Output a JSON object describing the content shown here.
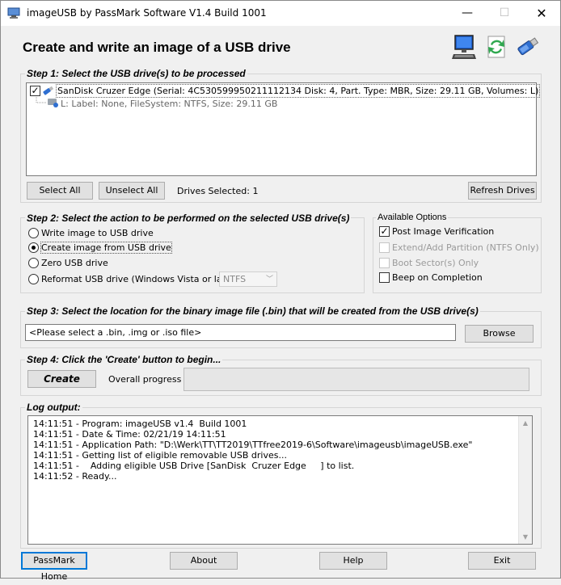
{
  "window": {
    "title": "imageUSB by PassMark Software V1.4 Build 1001",
    "minimize": "—",
    "maximize": "☐",
    "close": "✕"
  },
  "header": {
    "title": "Create and write an image of a USB drive",
    "icons": [
      "computer-icon",
      "refresh-arrows-icon",
      "usb-drive-icon"
    ]
  },
  "step1": {
    "label": "Step 1:  Select the USB drive(s) to be processed",
    "drive": "SanDisk Cruzer Edge (Serial: 4C530599950211112134 Disk: 4, Part. Type: MBR, Size: 29.11 GB, Volumes: L)",
    "volume": "L: Label: None, FileSystem: NTFS, Size: 29.11 GB",
    "drive_checked": true,
    "select_all": "Select All",
    "unselect_all": "Unselect All",
    "drives_selected": "Drives Selected: 1",
    "refresh": "Refresh Drives"
  },
  "step2": {
    "label": "Step 2: Select the action to be performed on the selected USB drive(s)",
    "options": [
      {
        "label": "Write image to USB drive",
        "checked": false
      },
      {
        "label": "Create image from USB drive",
        "checked": true
      },
      {
        "label": "Zero USB drive",
        "checked": false
      },
      {
        "label": "Reformat USB drive (Windows Vista or later)",
        "checked": false
      }
    ],
    "format_value": "NTFS"
  },
  "available_options": {
    "label": "Available Options",
    "items": [
      {
        "label": "Post Image Verification",
        "checked": true,
        "enabled": true
      },
      {
        "label": "Extend/Add Partition (NTFS Only)",
        "checked": false,
        "enabled": false
      },
      {
        "label": "Boot Sector(s) Only",
        "checked": false,
        "enabled": false
      },
      {
        "label": "Beep on Completion",
        "checked": false,
        "enabled": true
      }
    ]
  },
  "step3": {
    "label": "Step 3: Select the location for the binary image file (.bin) that will be created from the USB drive(s)",
    "file_value": "<Please select a .bin, .img or .iso file>",
    "browse": "Browse"
  },
  "step4": {
    "label": "Step 4: Click the 'Create' button to begin...",
    "create": "Create",
    "progress_label": "Overall progress",
    "progress_value": 0
  },
  "log": {
    "label": "Log output:",
    "lines": [
      "14:11:51 - Program: imageUSB v1.4  Build 1001",
      "14:11:51 - Date & Time: 02/21/19 14:11:51",
      "14:11:51 - Application Path: \"D:\\Werk\\TT\\TT2019\\TTfree2019-6\\Software\\imageusb\\imageUSB.exe\"",
      "14:11:51 - Getting list of eligible removable USB drives...",
      "14:11:51 -    Adding eligible USB Drive [SanDisk  Cruzer Edge     ] to list.",
      "14:11:52 - Ready..."
    ]
  },
  "footer": {
    "home": "PassMark Home",
    "about": "About",
    "help": "Help",
    "exit": "Exit"
  },
  "colors": {
    "accent": "#0078d7",
    "window_bg": "#f0f0f0",
    "disabled_text": "#9a9a9a"
  }
}
